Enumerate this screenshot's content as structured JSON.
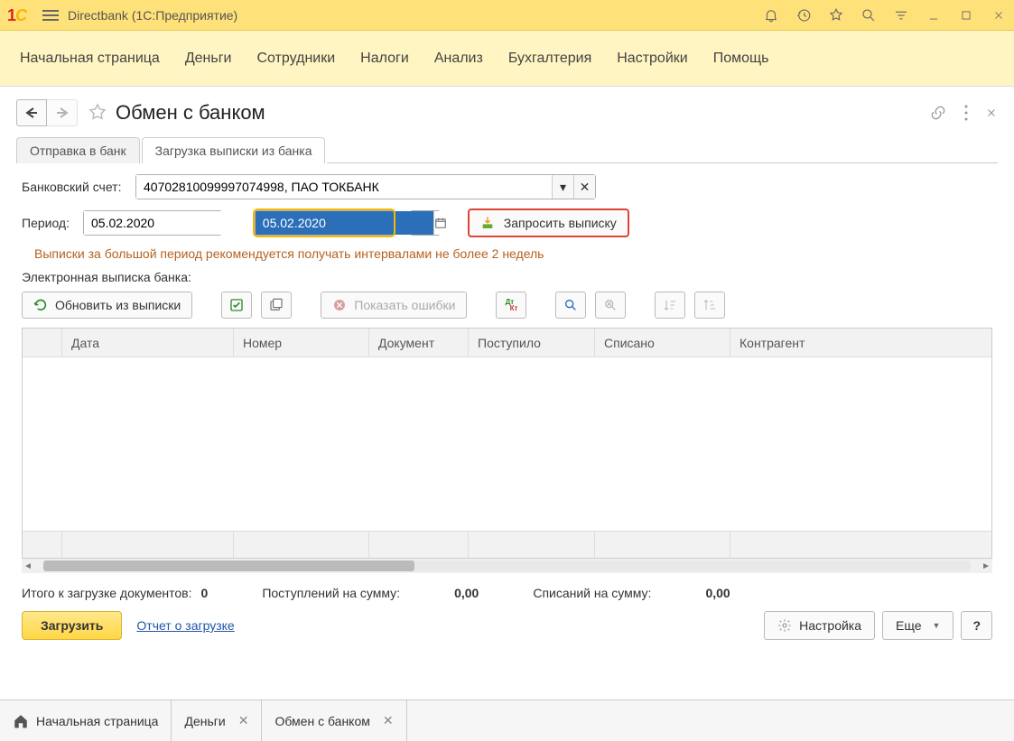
{
  "titlebar": {
    "app_title": "Directbank  (1С:Предприятие)"
  },
  "nav": {
    "items": [
      "Начальная страница",
      "Деньги",
      "Сотрудники",
      "Налоги",
      "Анализ",
      "Бухгалтерия",
      "Настройки",
      "Помощь"
    ]
  },
  "page": {
    "title": "Обмен с банком"
  },
  "tabs": {
    "t1": "Отправка в банк",
    "t2": "Загрузка выписки из банка"
  },
  "form": {
    "account_label": "Банковский счет:",
    "account_value": "40702810099997074998, ПАО ТОКБАНК",
    "period_label": "Период:",
    "date_from": "05.02.2020",
    "date_to": "05.02.2020",
    "ellipsis": "...",
    "request_button": "Запросить выписку",
    "warning": "Выписки за большой период рекомендуется получать интервалами не более 2 недель",
    "section_label": "Электронная выписка банка:"
  },
  "toolbar": {
    "refresh": "Обновить из выписки",
    "show_errors": "Показать ошибки"
  },
  "grid": {
    "cols": [
      "Дата",
      "Номер",
      "Документ",
      "Поступило",
      "Списано",
      "Контрагент"
    ]
  },
  "totals": {
    "docs_label": "Итого к загрузке документов:",
    "docs_value": "0",
    "in_label": "Поступлений на сумму:",
    "in_value": "0,00",
    "out_label": "Списаний на сумму:",
    "out_value": "0,00"
  },
  "footer": {
    "load": "Загрузить",
    "report": "Отчет о загрузке",
    "settings": "Настройка",
    "more": "Еще",
    "help": "?"
  },
  "taskbar": {
    "home": "Начальная страница",
    "t1": "Деньги",
    "t2": "Обмен с банком"
  }
}
